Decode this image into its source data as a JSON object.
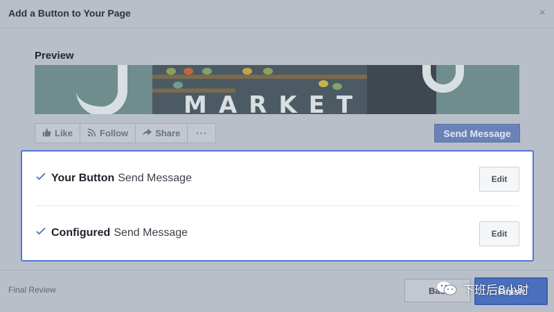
{
  "dialog": {
    "title": "Add a Button to Your Page",
    "close_icon": "close-icon",
    "close_glyph": "×"
  },
  "preview": {
    "label": "Preview",
    "cover_text": "MARKET",
    "actions": [
      {
        "label": "Like",
        "icon": "thumbs-up-icon"
      },
      {
        "label": "Follow",
        "icon": "rss-icon"
      },
      {
        "label": "Share",
        "icon": "share-arrow-icon"
      }
    ],
    "more_glyph": "···",
    "send_message_label": "Send Message"
  },
  "summary": {
    "rows": [
      {
        "title": "Your Button",
        "value": "Send Message",
        "edit_label": "Edit",
        "icon": "checkmark-icon"
      },
      {
        "title": "Configured",
        "value": "Send Message",
        "edit_label": "Edit",
        "icon": "checkmark-icon"
      }
    ]
  },
  "footer": {
    "step_label": "Final Review",
    "back_label": "Back",
    "finish_label": "Finish"
  },
  "watermark": {
    "text": "下班后8小时",
    "icon": "wechat-icon"
  },
  "colors": {
    "accent": "#4f75d6",
    "primary_button": "#4a6fbd",
    "overlay": "#b9bfc9"
  }
}
